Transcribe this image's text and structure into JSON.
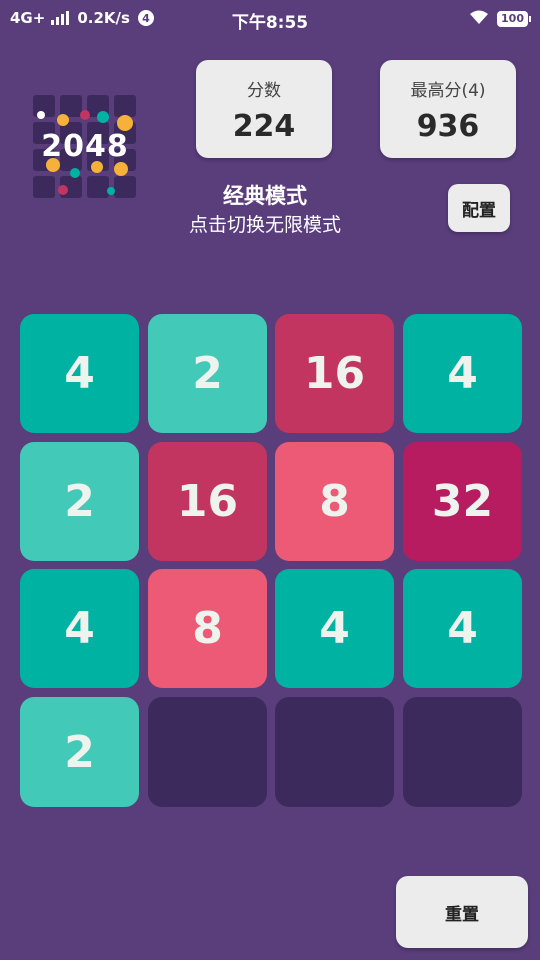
{
  "status_bar": {
    "network": "4G+",
    "speed": "0.2K/s",
    "notification_count": "4",
    "time": "下午8:55",
    "battery": "100"
  },
  "logo": {
    "text": "2048"
  },
  "score": {
    "label": "分数",
    "value": "224"
  },
  "best": {
    "label": "最高分(4)",
    "value": "936"
  },
  "mode": {
    "title": "经典模式",
    "subtitle": "点击切换无限模式"
  },
  "config_button": "配置",
  "reset_button": "重置",
  "board": {
    "rows": [
      [
        "4",
        "2",
        "16",
        "4"
      ],
      [
        "2",
        "16",
        "8",
        "32"
      ],
      [
        "4",
        "8",
        "4",
        "4"
      ],
      [
        "2",
        "",
        "",
        ""
      ]
    ]
  },
  "colors": {
    "background": "#5a3e7c",
    "empty": "#3c2a5c",
    "tile_2": "#42c9b7",
    "tile_4": "#00b2a2",
    "tile_8": "#ec5a75",
    "tile_16": "#c23560",
    "tile_32": "#b71c61"
  }
}
